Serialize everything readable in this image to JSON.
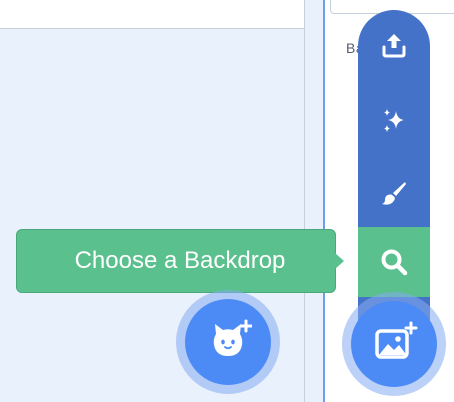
{
  "target_pane": {
    "backdrops_label": "Backdrops"
  },
  "tooltip": {
    "text": "Choose a Backdrop"
  },
  "backdrop_menu": {
    "items": [
      {
        "icon": "upload-icon"
      },
      {
        "icon": "sparkle-icon"
      },
      {
        "icon": "paintbrush-icon"
      },
      {
        "icon": "search-icon",
        "active": true
      }
    ]
  },
  "colors": {
    "menu_blue": "#4572c9",
    "active_green": "#59c08e",
    "button_blue": "#4c8bf5",
    "pane_bg": "#e9f1fc"
  }
}
